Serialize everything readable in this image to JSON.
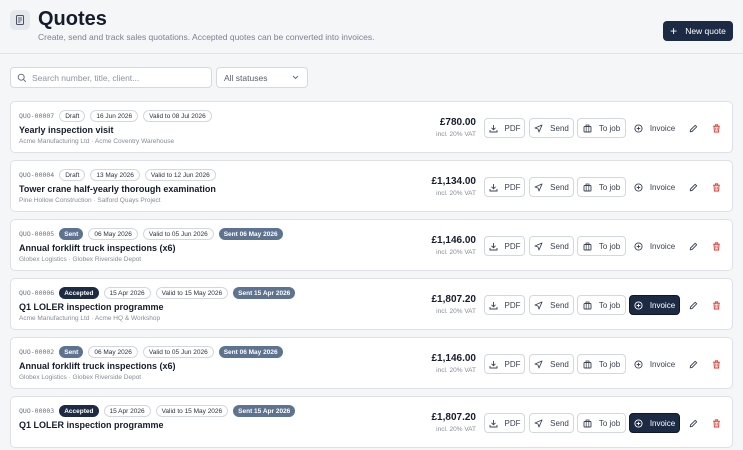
{
  "header": {
    "title": "Quotes",
    "subtitle": "Create, send and track sales quotations. Accepted quotes can be converted into invoices.",
    "new_quote_label": "New quote"
  },
  "filters": {
    "search_placeholder": "Search number, title, client...",
    "status_selected": "All statuses"
  },
  "actions": {
    "pdf": "PDF",
    "send": "Send",
    "to_job": "To job",
    "invoice": "Invoice"
  },
  "colors": {
    "primary": "#1c2a44",
    "sent_badge": "#5e7390",
    "delete": "#d9342b"
  },
  "quotes": [
    {
      "number": "QUO-00007",
      "status": "Draft",
      "status_kind": "draft",
      "date": "16 Jun 2026",
      "valid": "Valid to 08 Jul 2026",
      "sent": "",
      "title": "Yearly inspection visit",
      "client": "Acme Manufacturing Ltd · Acme Coventry Warehouse",
      "amount": "£780.00",
      "vat": "incl. 20% VAT",
      "invoice_style": "plain"
    },
    {
      "number": "QUO-00004",
      "status": "Draft",
      "status_kind": "draft",
      "date": "13 May 2026",
      "valid": "Valid to 12 Jun 2026",
      "sent": "",
      "title": "Tower crane half-yearly thorough examination",
      "client": "Pine Hollow Construction · Salford Quays Project",
      "amount": "£1,134.00",
      "vat": "incl. 20% VAT",
      "invoice_style": "plain"
    },
    {
      "number": "QUO-00005",
      "status": "Sent",
      "status_kind": "sent",
      "date": "06 May 2026",
      "valid": "Valid to 05 Jun 2026",
      "sent": "Sent 06 May 2026",
      "title": "Annual forklift truck inspections (x6)",
      "client": "Globex Logistics · Globex Riverside Depot",
      "amount": "£1,146.00",
      "vat": "incl. 20% VAT",
      "invoice_style": "plain"
    },
    {
      "number": "QUO-00006",
      "status": "Accepted",
      "status_kind": "accepted",
      "date": "15 Apr 2026",
      "valid": "Valid to 15 May 2026",
      "sent": "Sent 15 Apr 2026",
      "title": "Q1 LOLER inspection programme",
      "client": "Acme Manufacturing Ltd · Acme HQ & Workshop",
      "amount": "£1,807.20",
      "vat": "incl. 20% VAT",
      "invoice_style": "primary"
    },
    {
      "number": "QUO-00002",
      "status": "Sent",
      "status_kind": "sent",
      "date": "06 May 2026",
      "valid": "Valid to 05 Jun 2026",
      "sent": "Sent 06 May 2026",
      "title": "Annual forklift truck inspections (x6)",
      "client": "Globex Logistics · Globex Riverside Depot",
      "amount": "£1,146.00",
      "vat": "incl. 20% VAT",
      "invoice_style": "plain"
    },
    {
      "number": "QUO-00003",
      "status": "Accepted",
      "status_kind": "accepted",
      "date": "15 Apr 2026",
      "valid": "Valid to 15 May 2026",
      "sent": "Sent 15 Apr 2026",
      "title": "Q1 LOLER inspection programme",
      "client": "",
      "amount": "£1,807.20",
      "vat": "incl. 20% VAT",
      "invoice_style": "primary"
    }
  ]
}
